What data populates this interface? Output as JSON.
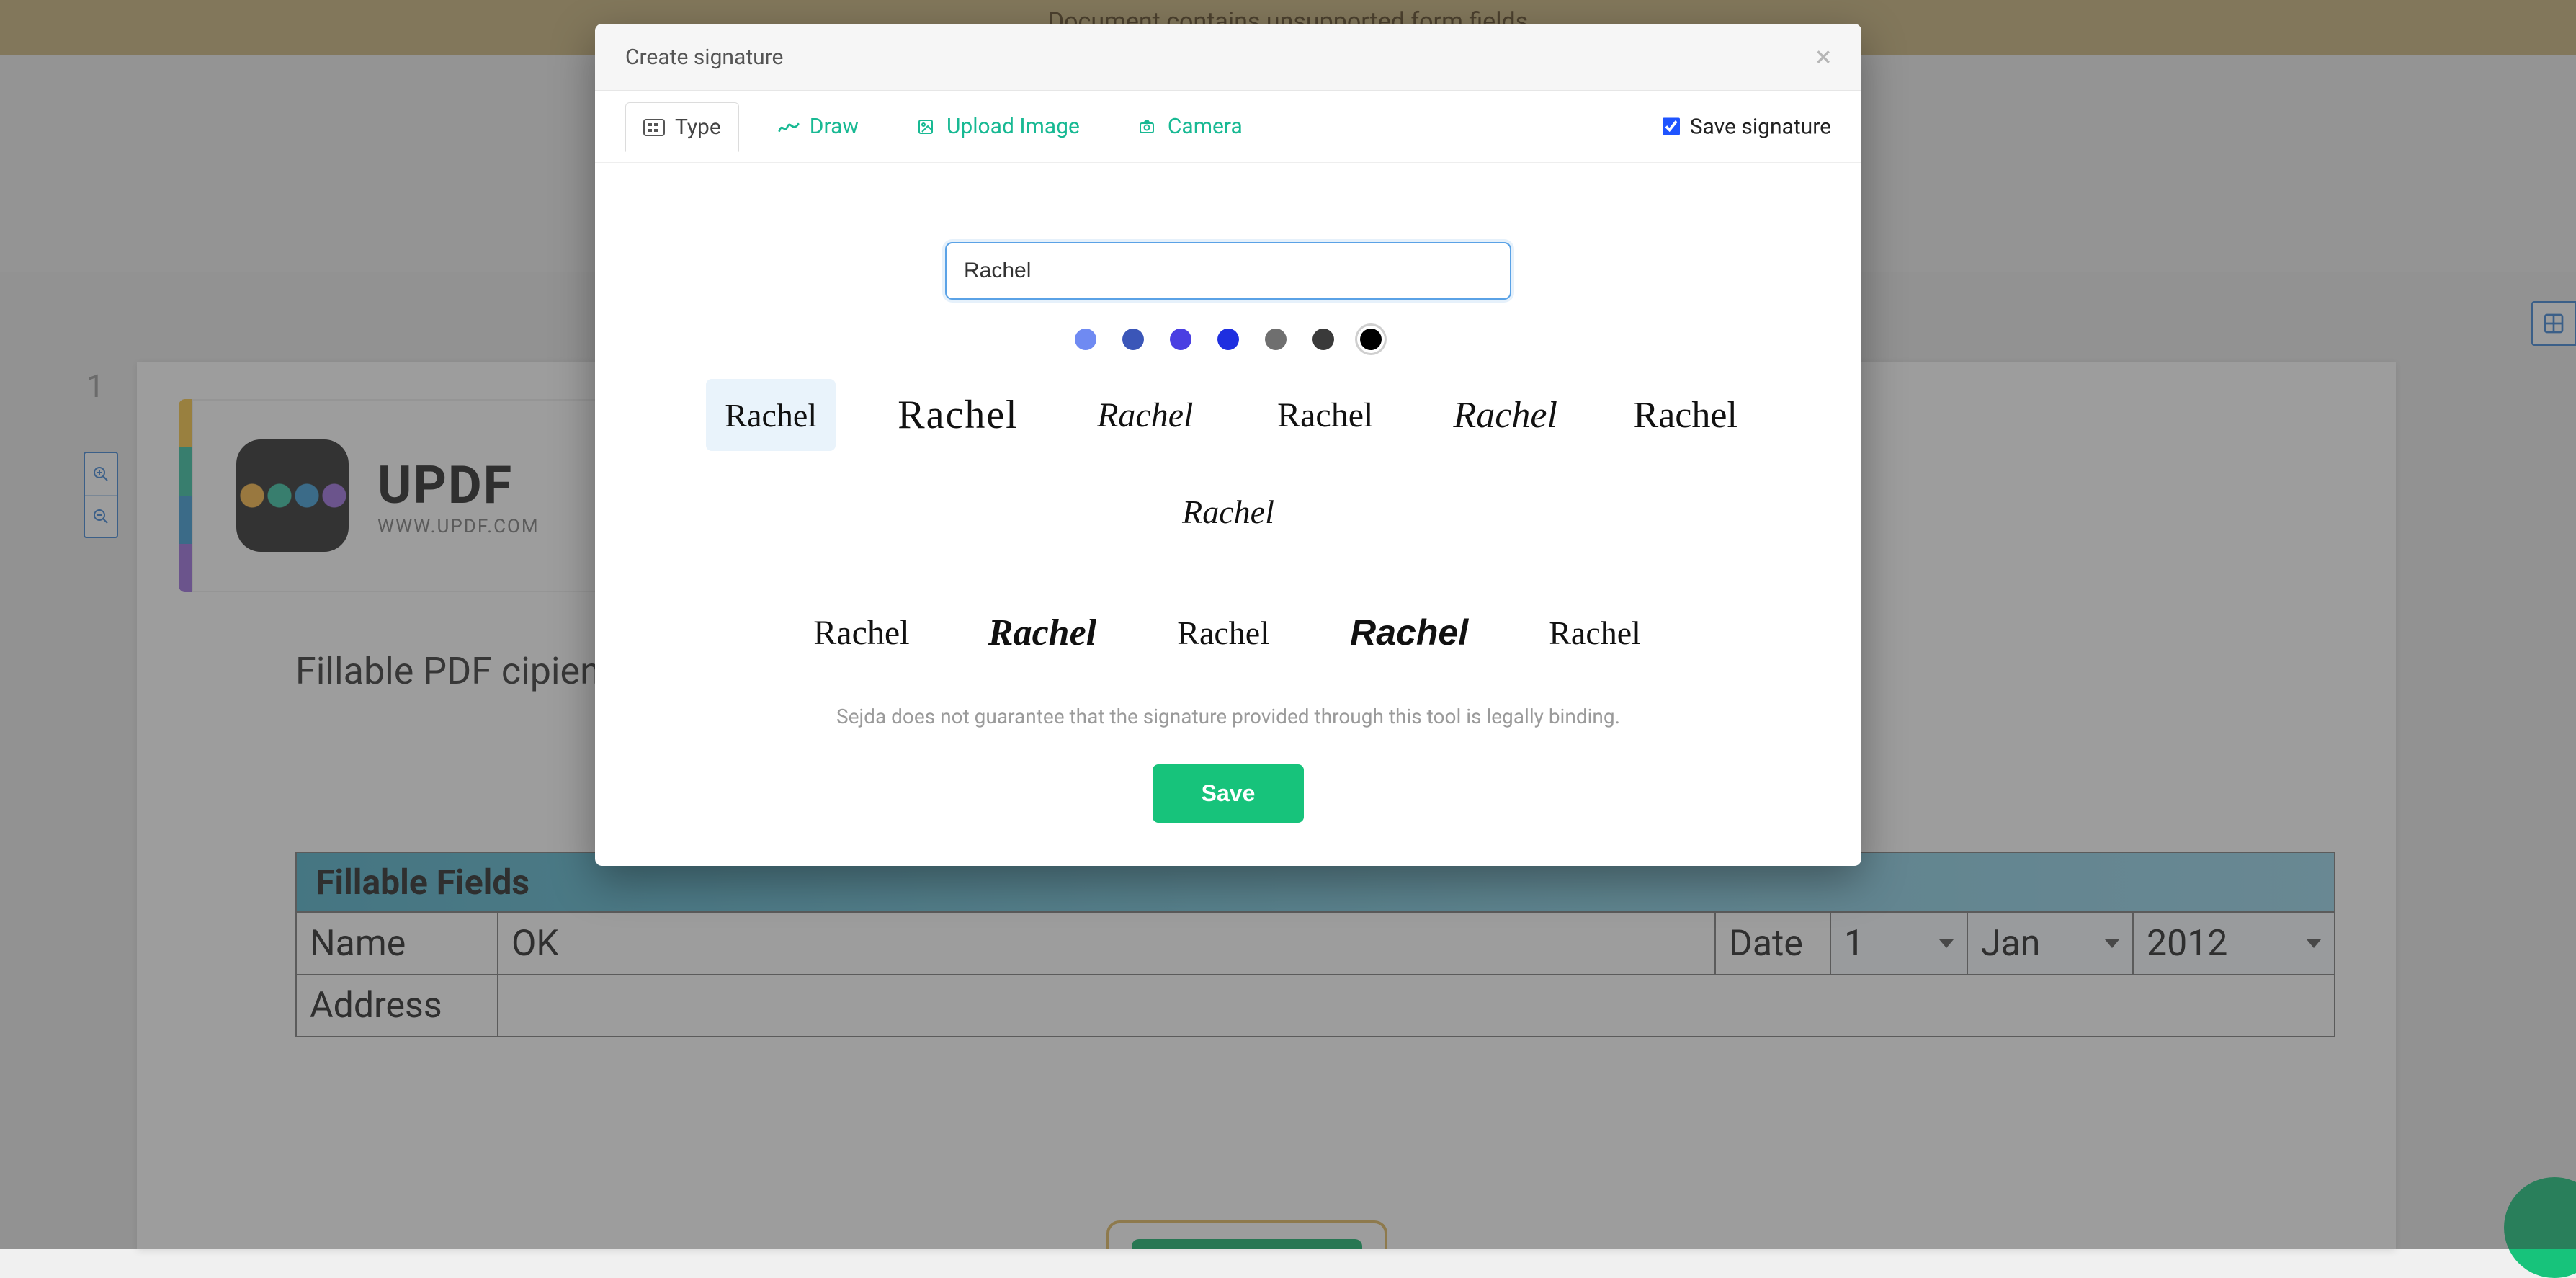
{
  "banner": {
    "message": "Document contains unsupported form fields"
  },
  "side": {
    "page_number": "1"
  },
  "logo": {
    "title": "UPDF",
    "sub": "WWW.UPDF.COM"
  },
  "doc": {
    "body_text": "Fillable PDF                                                                                                               cipients to fill out information or",
    "ff_heading": "Fillable Fields",
    "row1": {
      "label": "Name",
      "value": "OK",
      "date_label": "Date",
      "day": "1",
      "month": "Jan",
      "year": "2012"
    },
    "row2": {
      "label": "Address"
    }
  },
  "modal": {
    "title": "Create signature",
    "tabs": {
      "type": "Type",
      "draw": "Draw",
      "upload": "Upload Image",
      "camera": "Camera"
    },
    "save_label": "Save signature",
    "save_checked": true,
    "input_value": "Rachel",
    "colors": [
      "#6f8af2",
      "#3b56b8",
      "#4a3fe2",
      "#1f2fe0",
      "#6f6f6f",
      "#3a3a3a",
      "#000000"
    ],
    "selected_color_index": 6,
    "preview_text": "Rachel",
    "selected_style_index": 0,
    "legal": "Sejda does not guarantee that the signature provided through this tool is legally binding.",
    "save_button": "Save"
  }
}
